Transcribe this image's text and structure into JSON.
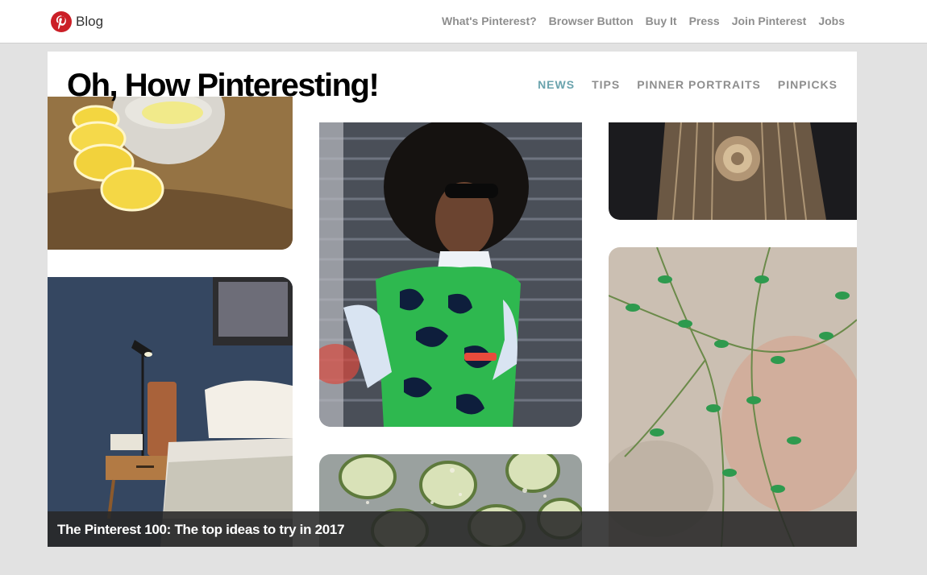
{
  "header": {
    "blog_label": "Blog",
    "nav": [
      "What's Pinterest?",
      "Browser Button",
      "Buy It",
      "Press",
      "Join Pinterest",
      "Jobs"
    ]
  },
  "panel": {
    "title": "Oh, How Pinteresting!",
    "sections": [
      {
        "label": "NEWS",
        "active": true
      },
      {
        "label": "TIPS",
        "active": false
      },
      {
        "label": "PINNER PORTRAITS",
        "active": false
      },
      {
        "label": "PINPICKS",
        "active": false
      }
    ]
  },
  "caption": "The Pinterest 100: The top ideas to try in 2017",
  "colors": {
    "brand_red": "#cb1f27",
    "active_nav": "#6aa3ad",
    "nav_gray": "#8e8e8e",
    "page_bg": "#e2e2e2"
  },
  "icons": {
    "logo": "pinterest-logo-icon"
  },
  "tiles": [
    {
      "name": "lemon-slices-photo"
    },
    {
      "name": "woman-portrait-photo"
    },
    {
      "name": "braided-hair-photo"
    },
    {
      "name": "bedroom-photo"
    },
    {
      "name": "cucumber-slices-photo"
    },
    {
      "name": "vine-plant-photo"
    }
  ]
}
